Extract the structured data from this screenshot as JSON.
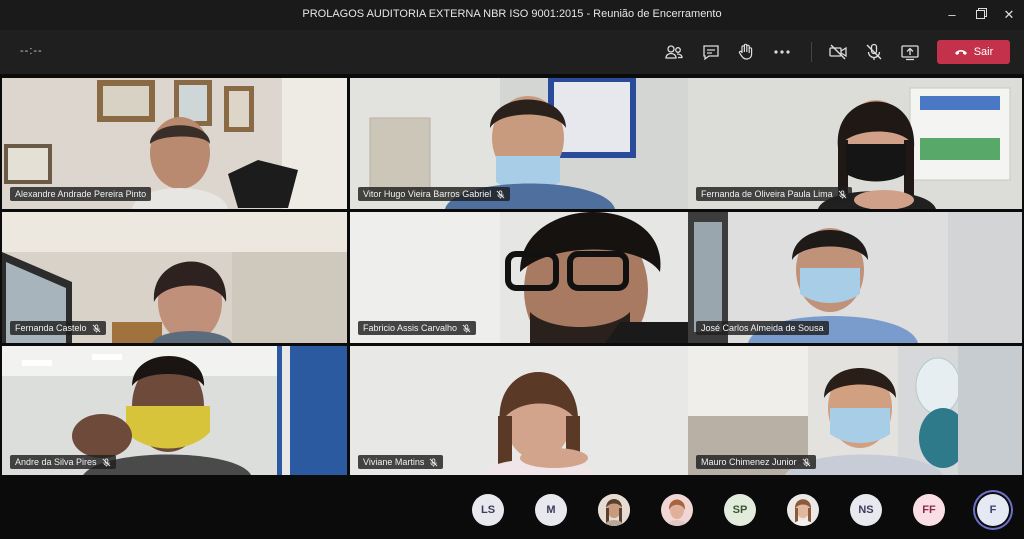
{
  "window": {
    "title": "PROLAGOS AUDITORIA EXTERNA NBR ISO 9001:2015 - Reunião de Encerramento",
    "minimize_icon": "minimize-icon",
    "restore_icon": "restore-icon",
    "close_icon": "close-icon"
  },
  "toolbar": {
    "timer": "--:--",
    "participants_icon": "people-icon",
    "chat_icon": "chat-icon",
    "raise_hand_icon": "hand-icon",
    "more_icon": "more-icon",
    "camera_icon": "camera-off-icon",
    "mic_icon": "mic-off-icon",
    "share_icon": "share-screen-icon",
    "leave_label": "Sair",
    "leave_color": "#c4314b"
  },
  "participants": [
    {
      "name": "Alexandre Andrade Pereira Pinto",
      "muted": false
    },
    {
      "name": "Vitor Hugo Vieira Barros Gabriel",
      "muted": true
    },
    {
      "name": "Fernanda de Oliveira Paula Lima",
      "muted": true
    },
    {
      "name": "Fernanda Castelo",
      "muted": true
    },
    {
      "name": "Fabricio Assis Carvalho",
      "muted": true
    },
    {
      "name": "José Carlos Almeida de Sousa",
      "muted": false
    },
    {
      "name": "Andre da Silva Pires",
      "muted": true
    },
    {
      "name": "Viviane Martins",
      "muted": true
    },
    {
      "name": "Mauro Chimenez Junior",
      "muted": true
    }
  ],
  "roster": [
    {
      "initials": "LS"
    },
    {
      "initials": "M"
    },
    {
      "initials": ""
    },
    {
      "initials": ""
    },
    {
      "initials": "SP"
    },
    {
      "initials": ""
    },
    {
      "initials": "NS"
    },
    {
      "initials": "FF"
    },
    {
      "initials": "F"
    }
  ]
}
